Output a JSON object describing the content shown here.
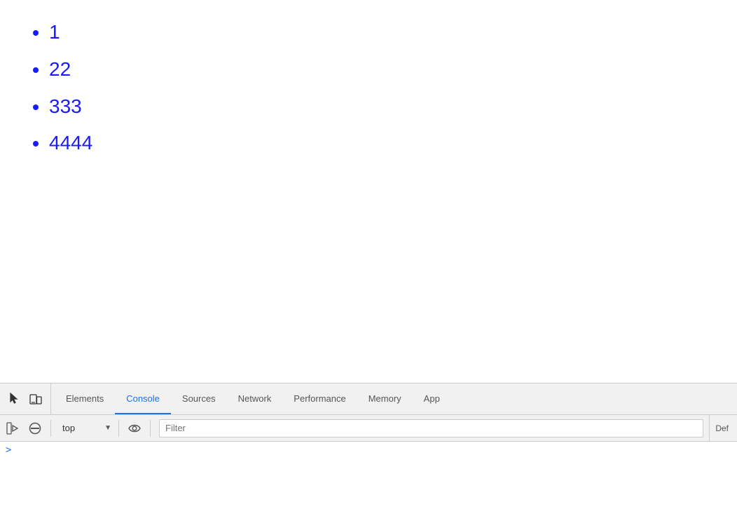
{
  "page": {
    "background": "#ffffff"
  },
  "content": {
    "list_items": [
      "1",
      "22",
      "333",
      "4444"
    ]
  },
  "devtools": {
    "tabs": [
      {
        "label": "Elements",
        "active": false
      },
      {
        "label": "Console",
        "active": true
      },
      {
        "label": "Sources",
        "active": false
      },
      {
        "label": "Network",
        "active": false
      },
      {
        "label": "Performance",
        "active": false
      },
      {
        "label": "Memory",
        "active": false
      },
      {
        "label": "App",
        "active": false
      }
    ],
    "console_toolbar": {
      "context_value": "top",
      "filter_placeholder": "Filter",
      "default_levels": "Def"
    },
    "console_prompt_symbol": ">"
  }
}
